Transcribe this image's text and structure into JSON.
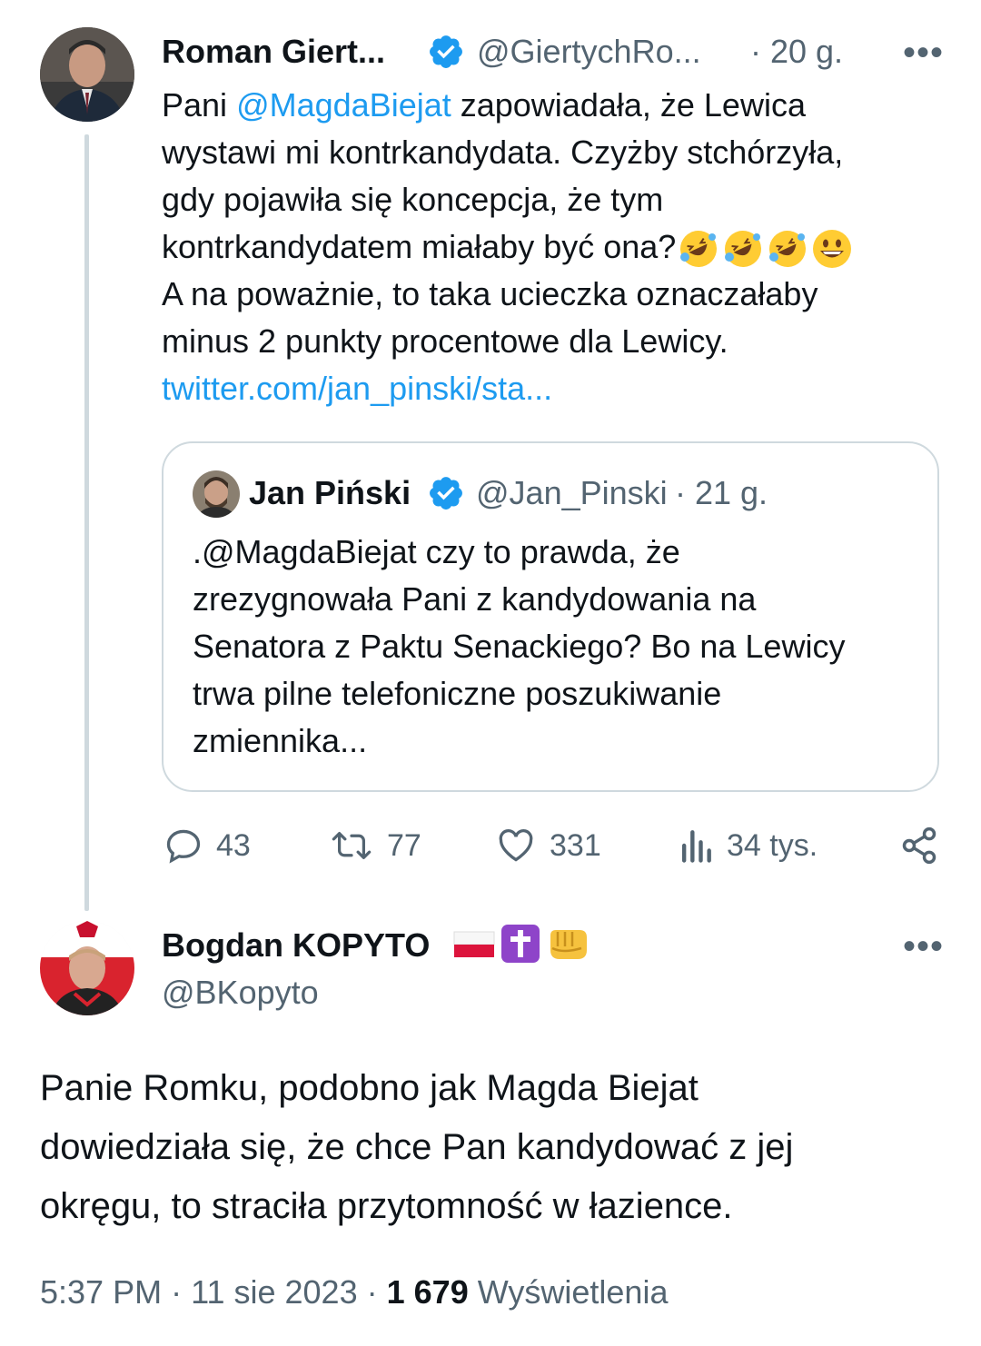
{
  "tweet": {
    "author_name": "Roman Giert...",
    "author_handle": "@GiertychRo...",
    "time": "· 20 g.",
    "more": "•••",
    "text_parts": {
      "line1_pre": "Pani ",
      "mention": "@MagdaBiejat",
      "line1_post": " zapowiadała, że Lewica",
      "line2": "wystawi mi kontrkandydata. Czyżby stchórzyła,",
      "line3": "gdy pojawiła się koncepcja, że tym",
      "line4": "kontrkandydatem miałaby być ona?",
      "line5": "A na poważnie, to taka ucieczka oznaczałaby",
      "line6": "minus 2 punkty procentowe dla Lewicy.",
      "link": "twitter.com/jan_pinski/sta..."
    },
    "emojis": [
      "rolling-on-floor-laughing",
      "rolling-on-floor-laughing",
      "rolling-on-floor-laughing",
      "grinning-face"
    ]
  },
  "quote": {
    "author_name": "Jan Piński",
    "author_handle": "@Jan_Pinski",
    "time": "· 21 g.",
    "lines": [
      ".@MagdaBiejat czy to prawda, że",
      "zrezygnowała Pani z kandydowania na",
      "Senatora z Paktu Senackiego? Bo na Lewicy",
      "trwa pilne telefoniczne poszukiwanie",
      "zmiennika..."
    ]
  },
  "actions": {
    "replies": "43",
    "retweets": "77",
    "likes": "331",
    "views": "34 tys."
  },
  "reply": {
    "author_name": "Bogdan KOPYTO",
    "author_handle": "@BKopyto",
    "name_emojis": [
      "flag-poland",
      "latin-cross",
      "oncoming-fist"
    ],
    "more": "•••",
    "lines": [
      "Panie Romku, podobno jak Magda Biejat",
      "dowiedziała się, że chce Pan kandydować z jej",
      "okręgu, to straciła przytomność w łazience."
    ],
    "time": "5:37 PM",
    "date": "11 sie 2023",
    "separator": "·",
    "views_count": "1 679",
    "views_label": "Wyświetlenia"
  },
  "colors": {
    "link": "#1d9bf0",
    "muted": "#536471",
    "border": "#cfd9de",
    "verified": "#1d9bf0"
  }
}
